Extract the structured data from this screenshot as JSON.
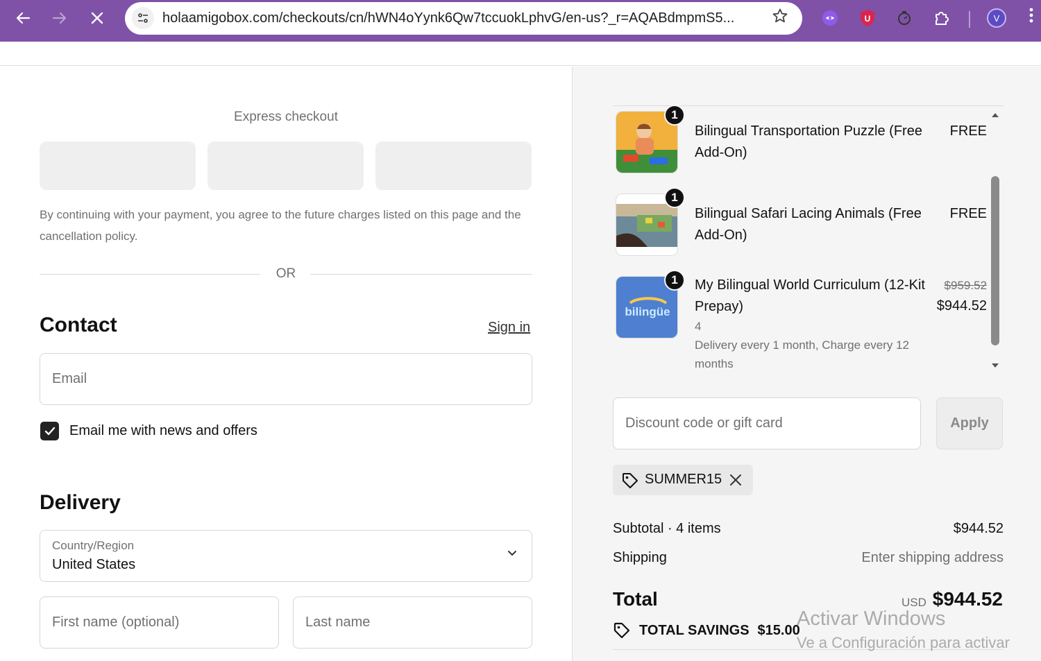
{
  "browser": {
    "url": "holaamigobox.com/checkouts/cn/hWN4oYynk6Qw7tccuokLphvG/en-us?_r=AQABdmpmS5...",
    "avatar_letter": "V",
    "extension_badge": "U"
  },
  "checkout": {
    "express_title": "Express checkout",
    "terms": "By continuing with your payment, you agree to the future charges listed on this page and the cancellation policy.",
    "or_label": "OR",
    "contact": {
      "heading": "Contact",
      "sign_in": "Sign in",
      "email_placeholder": "Email",
      "news_label": "Email me with news and offers",
      "news_checked": true
    },
    "delivery": {
      "heading": "Delivery",
      "country_label": "Country/Region",
      "country_value": "United States",
      "first_name_placeholder": "First name (optional)",
      "last_name_placeholder": "Last name"
    }
  },
  "summary": {
    "items": [
      {
        "qty": "1",
        "name": "Bilingual Transportation Puzzle (Free Add-On)",
        "price": "FREE"
      },
      {
        "qty": "1",
        "name": "Bilingual Safari Lacing Animals (Free Add-On)",
        "price": "FREE"
      },
      {
        "qty": "1",
        "name": "My Bilingual World Curriculum (12-Kit Prepay)",
        "variant": "4",
        "note": "Delivery every 1 month, Charge every 12 months",
        "original_price": "$959.52",
        "price": "$944.52",
        "logo_text": "bilingüe"
      }
    ],
    "discount_placeholder": "Discount code or gift card",
    "apply_label": "Apply",
    "applied_code": "SUMMER15",
    "subtotal_label": "Subtotal · 4 items",
    "subtotal_value": "$944.52",
    "shipping_label": "Shipping",
    "shipping_value": "Enter shipping address",
    "total_label": "Total",
    "total_currency": "USD",
    "total_value": "$944.52",
    "savings_label": "TOTAL SAVINGS",
    "savings_value": "$15.00"
  },
  "watermark": {
    "line1": "Activar Windows",
    "line2": "Ve a Configuración para activar"
  },
  "colors": {
    "browser_frame": "#7f52a8",
    "summary_bg": "#f5f5f5",
    "checkbox": "#222222"
  }
}
